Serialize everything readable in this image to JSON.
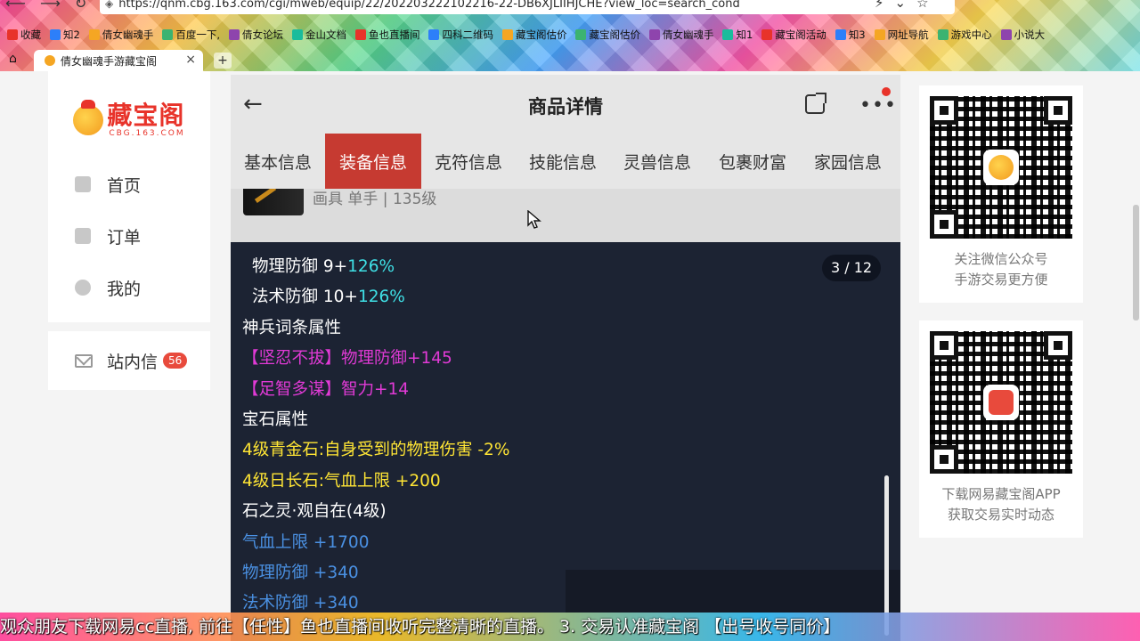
{
  "browser": {
    "url": "https://qnm.cbg.163.com/cgi/mweb/equip/22/202203222102216-22-DB6XJLIIHJCHE?view_loc=search_cond",
    "bookmarks": [
      "收藏",
      "知2",
      "倩女幽魂手",
      "百度一下,",
      "倩女论坛",
      "金山文档",
      "鱼也直播间",
      "四科二维码",
      "藏宝阁估价",
      "藏宝阁估价",
      "倩女幽魂手",
      "知1",
      "藏宝阁活动",
      "知3",
      "网址导航",
      "游戏中心",
      "小说大"
    ],
    "tab_title": "倩女幽魂手游藏宝阁"
  },
  "sidebar": {
    "logo_title": "藏宝阁",
    "logo_sub": "CBG.163.COM",
    "menu": [
      {
        "label": "首页"
      },
      {
        "label": "订单"
      },
      {
        "label": "我的"
      }
    ],
    "mail_label": "站内信",
    "mail_badge": "56"
  },
  "detail_header": {
    "title": "商品详情"
  },
  "tabs": [
    {
      "label": "基本信息",
      "active": false
    },
    {
      "label": "装备信息",
      "active": true
    },
    {
      "label": "克符信息",
      "active": false
    },
    {
      "label": "技能信息",
      "active": false
    },
    {
      "label": "灵兽信息",
      "active": false
    },
    {
      "label": "包裹财富",
      "active": false
    },
    {
      "label": "家园信息",
      "active": false
    }
  ],
  "item": {
    "desc": "画具 单手 | 135级"
  },
  "detail": {
    "counter": "3 / 12",
    "lines": [
      {
        "parts": [
          {
            "text": "物理防御 9+",
            "color": "white"
          },
          {
            "text": "126%",
            "color": "cyan"
          }
        ],
        "indent": true
      },
      {
        "parts": [
          {
            "text": "法术防御 10+",
            "color": "white"
          },
          {
            "text": "126%",
            "color": "cyan"
          }
        ],
        "indent": true
      },
      {
        "parts": [
          {
            "text": "神兵词条属性",
            "color": "white"
          }
        ],
        "indent": false
      },
      {
        "parts": [
          {
            "text": "【坚忍不拔】物理防御+145",
            "color": "magenta"
          }
        ],
        "indent": false
      },
      {
        "parts": [
          {
            "text": "【足智多谋】智力+14",
            "color": "magenta"
          }
        ],
        "indent": false
      },
      {
        "parts": [
          {
            "text": "宝石属性",
            "color": "white"
          }
        ],
        "indent": false
      },
      {
        "parts": [
          {
            "text": "4级青金石:自身受到的物理伤害 -2%",
            "color": "yellow"
          }
        ],
        "indent": false
      },
      {
        "parts": [
          {
            "text": "4级日长石:气血上限 +200",
            "color": "yellow"
          }
        ],
        "indent": false
      },
      {
        "parts": [
          {
            "text": "石之灵·观自在(4级)",
            "color": "white"
          }
        ],
        "indent": false
      },
      {
        "parts": [
          {
            "text": "气血上限 +1700",
            "color": "blue"
          }
        ],
        "indent": false
      },
      {
        "parts": [
          {
            "text": "物理防御 +340",
            "color": "blue"
          }
        ],
        "indent": false
      },
      {
        "parts": [
          {
            "text": "法术防御 +340",
            "color": "blue"
          }
        ],
        "indent": false
      }
    ]
  },
  "qr_cards": [
    {
      "line1": "关注微信公众号",
      "line2": "手游交易更方便"
    },
    {
      "line1": "下载网易藏宝阁APP",
      "line2": "获取交易实时动态"
    }
  ],
  "ticker": {
    "text": "观众朋友下载网易cc直播, 前往【任性】鱼也直播间收听完整清晰的直播。 3. 交易认准藏宝阁 【出号收号同价】"
  },
  "colors": {
    "brand_red": "#e8332a",
    "active_tab": "#c63a31",
    "detail_bg": "#1c2333",
    "cyan": "#3fe0e6",
    "magenta": "#e13ad6",
    "yellow": "#ffe534",
    "blue": "#4a90e2"
  }
}
